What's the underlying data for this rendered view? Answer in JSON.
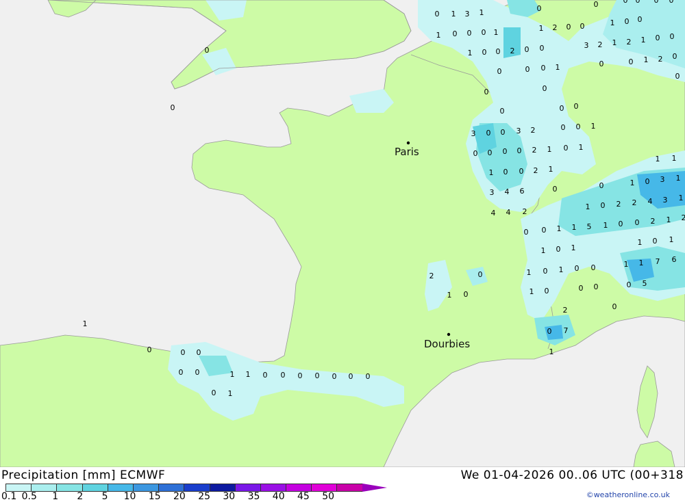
{
  "title": "Precipitation [mm] ECMWF",
  "datetime": "We 01-04-2026 00..06 UTC (00+318",
  "credit": "©weatheronline.co.uk",
  "colors": {
    "sea": "#f0f0f0",
    "land": "#cdfba6",
    "border": "#999999"
  },
  "legend": {
    "labels": [
      "0.1",
      "0.5",
      "1",
      "2",
      "5",
      "10",
      "15",
      "20",
      "25",
      "30",
      "35",
      "40",
      "45",
      "50"
    ],
    "colors": [
      "#c9f5f5",
      "#aaeeee",
      "#86e4e4",
      "#5fd3e0",
      "#46b8e8",
      "#3c97e0",
      "#2e70d6",
      "#1a3ecc",
      "#0d1aa0",
      "#7a18e8",
      "#9a10e6",
      "#c400e0",
      "#e000d8",
      "#c800a8"
    ]
  },
  "cities": [
    {
      "name": "Paris"
    },
    {
      "name": "Dourbies"
    }
  ],
  "values": [
    "0",
    "1",
    "3",
    "1",
    "0",
    "0",
    "0",
    "0",
    "0",
    "0",
    "1",
    "0",
    "0",
    "0",
    "1",
    "1",
    "2",
    "0",
    "0",
    "1",
    "0",
    "0",
    "1",
    "0",
    "0",
    "2",
    "0",
    "0",
    "3",
    "2",
    "1",
    "2",
    "1",
    "0",
    "0",
    "0",
    "0",
    "1",
    "2",
    "0",
    "0",
    "0",
    "0",
    "1",
    "0",
    "0",
    "0",
    "0",
    "0",
    "0",
    "3",
    "0",
    "0",
    "3",
    "2",
    "0",
    "0",
    "1",
    "0",
    "0",
    "0",
    "0",
    "2",
    "1",
    "0",
    "1",
    "1",
    "0",
    "0",
    "2",
    "1",
    "1",
    "1",
    "0",
    "1",
    "0",
    "3",
    "1",
    "3",
    "4",
    "6",
    "0",
    "1",
    "1",
    "0",
    "2",
    "2",
    "4",
    "3",
    "4",
    "4",
    "2",
    "0",
    "0",
    "1",
    "1",
    "5",
    "1",
    "0",
    "0",
    "2",
    "1",
    "2",
    "1",
    "0",
    "1",
    "1",
    "0",
    "1",
    "1",
    "1",
    "7",
    "6",
    "2",
    "0",
    "1",
    "0",
    "1",
    "0",
    "0",
    "0",
    "5",
    "1",
    "0",
    "1",
    "0",
    "0",
    "0",
    "1",
    "0",
    "2",
    "0",
    "7",
    "1",
    "0",
    "0",
    "0",
    "0",
    "0",
    "1",
    "1",
    "0",
    "0",
    "0",
    "0",
    "0",
    "0",
    "0",
    "0",
    "1",
    "0",
    "0"
  ]
}
